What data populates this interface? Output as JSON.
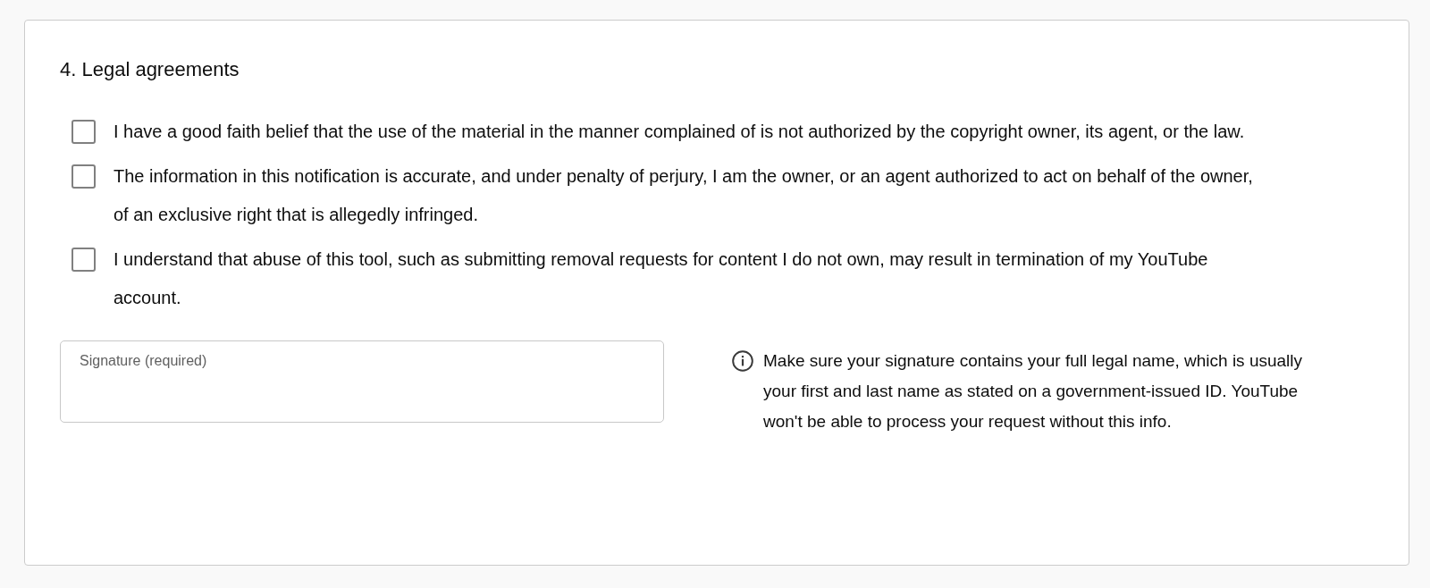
{
  "section": {
    "title": "4. Legal agreements",
    "agreements": [
      {
        "text": "I have a good faith belief that the use of the material in the manner complained of is not authorized by the copyright owner, its agent, or the law.",
        "checked": false
      },
      {
        "text": "The information in this notification is accurate, and under penalty of perjury, I am the owner, or an agent authorized to act on behalf of the owner, of an exclusive right that is allegedly infringed.",
        "checked": false
      },
      {
        "text": "I understand that abuse of this tool, such as submitting removal requests for content I do not own, may result in termination of my YouTube account.",
        "checked": false
      }
    ],
    "signature": {
      "placeholder": "Signature (required)"
    },
    "info": "Make sure your signature contains your full legal name, which is usually your first and last name as stated on a government-issued ID. YouTube won't be able to process your request without this info."
  }
}
